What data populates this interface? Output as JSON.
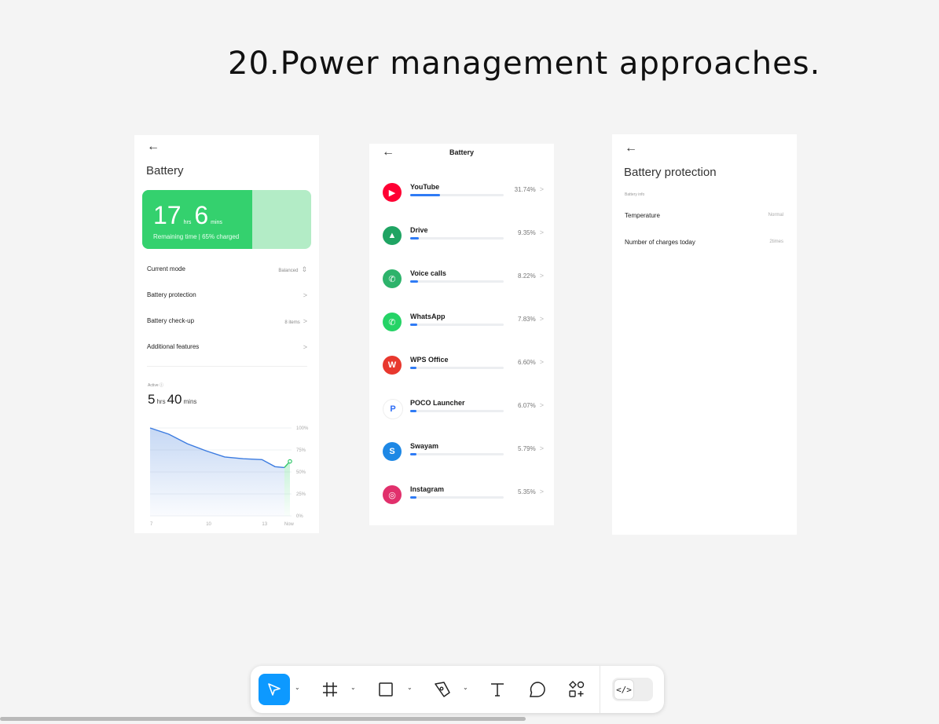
{
  "page_title": "20.Power management approaches.",
  "card1": {
    "title": "Battery",
    "remaining": {
      "hours": "17",
      "hours_unit": "hrs",
      "mins": "6",
      "mins_unit": "mins",
      "subtitle": "Remaining time | 65% charged",
      "charged_fraction": 0.65
    },
    "rows": [
      {
        "label": "Current mode",
        "value": "Balanced",
        "chevron": "⇕"
      },
      {
        "label": "Battery protection",
        "value": "",
        "chevron": ">"
      },
      {
        "label": "Battery check-up",
        "value": "8 items",
        "chevron": ">"
      },
      {
        "label": "Additional features",
        "value": "",
        "chevron": ">"
      }
    ],
    "active": {
      "label": "Active",
      "hours": "5",
      "hours_unit": "hrs",
      "mins": "40",
      "mins_unit": "mins"
    }
  },
  "chart_data": {
    "type": "area",
    "x_ticks": [
      "7",
      "10",
      "13",
      "Now"
    ],
    "y_ticks": [
      "100%",
      "75%",
      "50%",
      "25%",
      "0%"
    ],
    "ylim": [
      0,
      100
    ],
    "series": [
      {
        "x": [
          7,
          8,
          9,
          10,
          11,
          12,
          13,
          13.7,
          14.2,
          14.5
        ],
        "values": [
          100,
          93,
          82,
          74,
          67,
          65,
          64,
          56,
          55,
          62
        ]
      }
    ]
  },
  "card2": {
    "title": "Battery",
    "apps": [
      {
        "name": "YouTube",
        "percent": "31.74%",
        "fraction": 0.3174,
        "icon": "youtube-icon",
        "color": "#ff0033",
        "glyph": "▶"
      },
      {
        "name": "Drive",
        "percent": "9.35%",
        "fraction": 0.0935,
        "icon": "drive-icon",
        "color": "#1fa463",
        "glyph": "▲"
      },
      {
        "name": "Voice calls",
        "percent": "8.22%",
        "fraction": 0.0822,
        "icon": "phone-icon",
        "color": "#2db36b",
        "glyph": "✆"
      },
      {
        "name": "WhatsApp",
        "percent": "7.83%",
        "fraction": 0.0783,
        "icon": "whatsapp-icon",
        "color": "#25d366",
        "glyph": "✆"
      },
      {
        "name": "WPS Office",
        "percent": "6.60%",
        "fraction": 0.066,
        "icon": "wps-office-icon",
        "color": "#e8382e",
        "glyph": "W"
      },
      {
        "name": "POCO Launcher",
        "percent": "6.07%",
        "fraction": 0.0607,
        "icon": "poco-launcher-icon",
        "color": "#ffffff",
        "glyph": "P"
      },
      {
        "name": "Swayam",
        "percent": "5.79%",
        "fraction": 0.0579,
        "icon": "swayam-icon",
        "color": "#1e88e5",
        "glyph": "S"
      },
      {
        "name": "Instagram",
        "percent": "5.35%",
        "fraction": 0.0535,
        "icon": "instagram-icon",
        "color": "#e1306c",
        "glyph": "◎"
      }
    ]
  },
  "card3": {
    "title": "Battery protection",
    "section_label": "Battery info",
    "rows": [
      {
        "label": "Temperature",
        "value": "Normal"
      },
      {
        "label": "Number of charges today",
        "value": "2times"
      }
    ]
  },
  "toolbar": {
    "tools": [
      "move-tool",
      "frame-tool",
      "rectangle-tool",
      "pen-tool",
      "text-tool",
      "comment-tool",
      "resources-tool"
    ],
    "dev_mode_glyph": "</>",
    "accent": "#0d99ff"
  }
}
